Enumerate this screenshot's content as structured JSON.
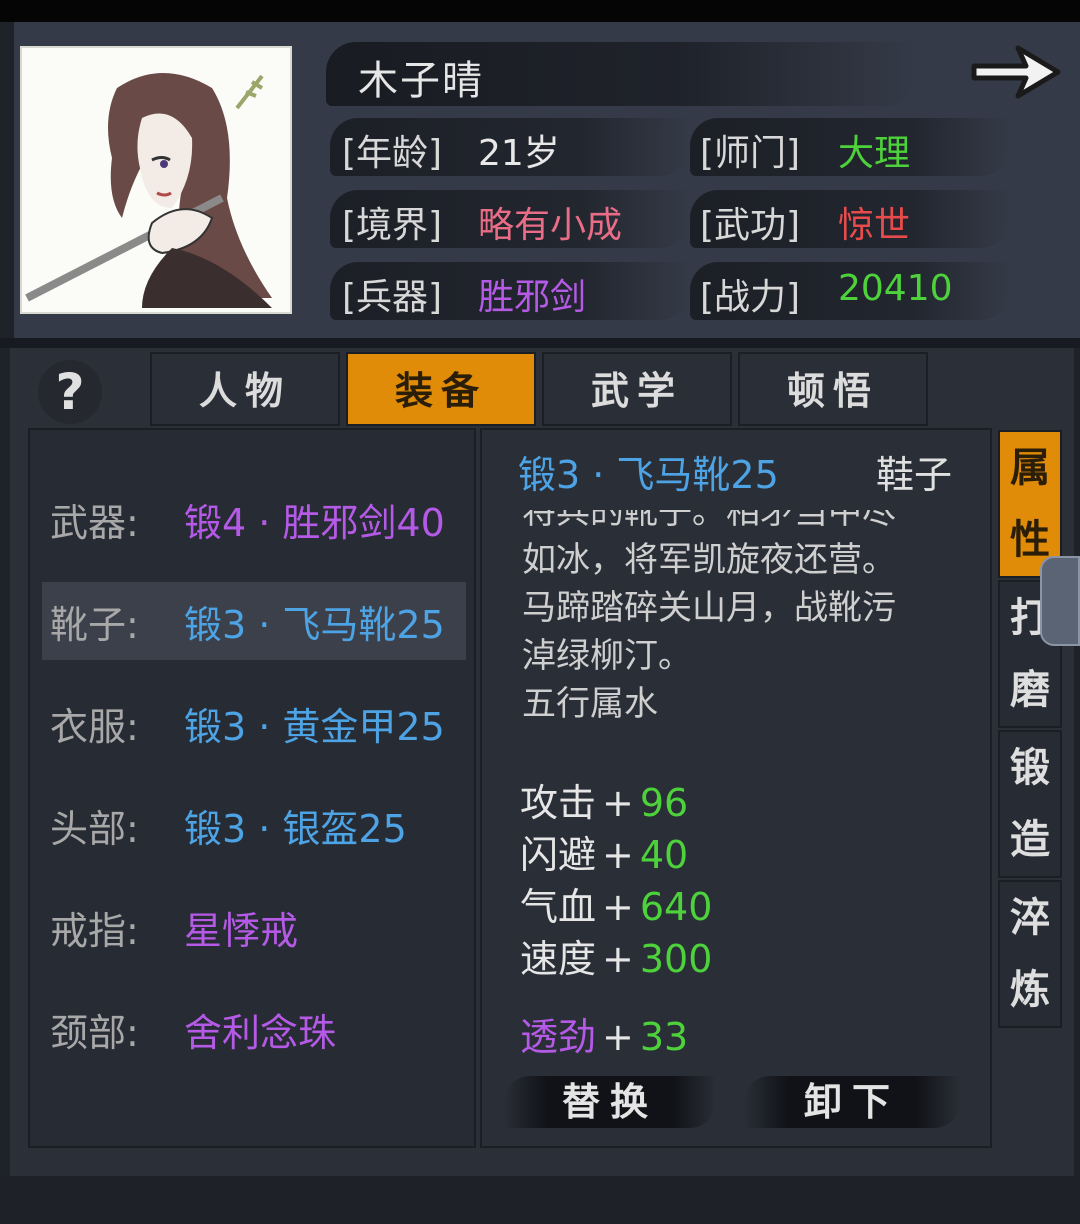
{
  "character": {
    "name": "木子晴",
    "age_label": "[年龄]",
    "age_value": "21岁",
    "sect_label": "[师门]",
    "sect_value": "大理",
    "realm_label": "[境界]",
    "realm_value": "略有小成",
    "martial_label": "[武功]",
    "martial_value": "惊世",
    "weapon_label": "[兵器]",
    "weapon_value": "胜邪剑",
    "power_label": "[战力]",
    "power_value": "20410"
  },
  "help_label": "?",
  "tabs": [
    "人物",
    "装备",
    "武学",
    "顿悟"
  ],
  "active_tab": "装备",
  "slots": [
    {
      "label": "武器:",
      "value": "锻4 · 胜邪剑40",
      "color": "#b55ae6"
    },
    {
      "label": "靴子:",
      "value": "锻3 · 飞马靴25",
      "color": "#4da3e4"
    },
    {
      "label": "衣服:",
      "value": "锻3 · 黄金甲25",
      "color": "#4da3e4"
    },
    {
      "label": "头部:",
      "value": "锻3 · 银盔25",
      "color": "#4da3e4"
    },
    {
      "label": "戒指:",
      "value": "星悸戒",
      "color": "#b55ae6"
    },
    {
      "label": "颈部:",
      "value": "舍利念珠",
      "color": "#b55ae6"
    }
  ],
  "selected_slot": "靴子:",
  "detail": {
    "item_name": "锻3 · 飞马靴25",
    "item_type": "鞋子",
    "desc_cut": "将兵的靴子。相矛当中尽",
    "desc_lines": [
      "如冰，将军凯旋夜还营。",
      "马蹄踏碎关山月，战靴污",
      "淖绿柳汀。",
      "五行属水"
    ],
    "stats": [
      {
        "key": "攻击",
        "sign": "+",
        "value": "96"
      },
      {
        "key": "闪避",
        "sign": "+",
        "value": "40"
      },
      {
        "key": "气血",
        "sign": "+",
        "value": "640"
      },
      {
        "key": "速度",
        "sign": "+",
        "value": "300"
      }
    ],
    "special_stat": {
      "key": "透劲",
      "sign": "+",
      "value": "33"
    },
    "replace_button": "替换",
    "unequip_button": "卸下"
  },
  "side_tabs": [
    "属性",
    "打磨",
    "锻造",
    "淬炼"
  ],
  "colors": {
    "accent": "#e08c09",
    "green": "#4ed23b",
    "blue": "#4da3e4",
    "purple": "#b55ae6",
    "red": "#e84b4b",
    "pink": "#e96d86"
  },
  "icons": {
    "next": "right-arrow-icon",
    "help": "question-mark-icon"
  }
}
